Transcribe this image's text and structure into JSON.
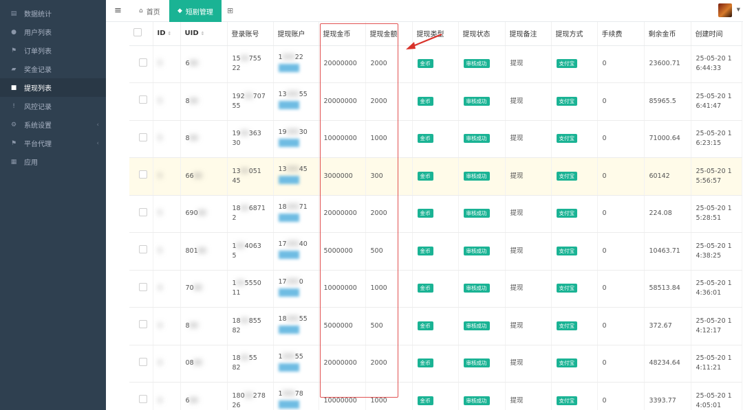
{
  "sidebar": {
    "items": [
      {
        "label": "数据统计",
        "icon": "chart-icon"
      },
      {
        "label": "用户列表",
        "icon": "user-icon"
      },
      {
        "label": "订单列表",
        "icon": "flag-icon"
      },
      {
        "label": "奖金记录",
        "icon": "book-icon"
      },
      {
        "label": "提现列表",
        "icon": "briefcase-icon",
        "active": true
      },
      {
        "label": "风控记录",
        "icon": "exclamation-icon"
      },
      {
        "label": "系统设置",
        "icon": "gear-icon",
        "has_children": true
      },
      {
        "label": "平台代理",
        "icon": "flag-icon",
        "has_children": true
      },
      {
        "label": "应用",
        "icon": "grid-icon"
      }
    ]
  },
  "topbar": {
    "home_label": "首页",
    "active_tab_label": "短剧管理"
  },
  "table": {
    "columns": [
      "ID",
      "UID",
      "登录账号",
      "提现账户",
      "提现金币",
      "提现金额",
      "提现类型",
      "提现状态",
      "提现备注",
      "提现方式",
      "手续费",
      "剩余金币",
      "创建时间"
    ],
    "rows": [
      {
        "id": "5",
        "uid": "6",
        "login": "15",
        "login2": "755",
        "login3": "22",
        "acct": "1",
        "acct2": "22",
        "coins": "20000000",
        "amount": "2000",
        "type": "金币",
        "status": "审核成功",
        "remark": "提现",
        "method": "支付宝",
        "fee": "0",
        "balance": "23600.71",
        "date": "25-05-20 1",
        "time": "6:44:33"
      },
      {
        "id": "5",
        "uid": "8",
        "login": "192",
        "login2": "707",
        "login3": "55",
        "acct": "13",
        "acct2": "55",
        "coins": "20000000",
        "amount": "2000",
        "type": "金币",
        "status": "审核成功",
        "remark": "提现",
        "method": "支付宝",
        "fee": "0",
        "balance": "85965.5",
        "date": "25-05-20 1",
        "time": "6:41:47"
      },
      {
        "id": "5",
        "uid": "8",
        "login": "19",
        "login2": "363",
        "login3": "30",
        "acct": "19",
        "acct2": "30",
        "coins": "10000000",
        "amount": "1000",
        "type": "金币",
        "status": "审核成功",
        "remark": "提现",
        "method": "支付宝",
        "fee": "0",
        "balance": "71000.64",
        "date": "25-05-20 1",
        "time": "6:23:15"
      },
      {
        "id": "5",
        "uid": "66",
        "login": "13",
        "login2": "051",
        "login3": "45",
        "acct": "13",
        "acct2": "45",
        "coins": "3000000",
        "amount": "300",
        "type": "金币",
        "status": "审核成功",
        "remark": "提现",
        "method": "支付宝",
        "fee": "0",
        "balance": "60142",
        "date": "25-05-20 1",
        "time": "5:56:57"
      },
      {
        "id": "5",
        "uid": "690",
        "login": "18",
        "login2": "6871",
        "login3": "2",
        "acct": "18",
        "acct2": "71",
        "coins": "20000000",
        "amount": "2000",
        "type": "金币",
        "status": "审核成功",
        "remark": "提现",
        "method": "支付宝",
        "fee": "0",
        "balance": "224.08",
        "date": "25-05-20 1",
        "time": "5:28:51"
      },
      {
        "id": "5",
        "uid": "801",
        "login": "1",
        "login2": "4063",
        "login3": "5",
        "acct": "17",
        "acct2": "40",
        "coins": "5000000",
        "amount": "500",
        "type": "金币",
        "status": "审核成功",
        "remark": "提现",
        "method": "支付宝",
        "fee": "0",
        "balance": "10463.71",
        "date": "25-05-20 1",
        "time": "4:38:25"
      },
      {
        "id": "4",
        "uid": "70",
        "login": "1",
        "login2": "5550",
        "login3": "11",
        "acct": "17",
        "acct2": "0",
        "coins": "10000000",
        "amount": "1000",
        "type": "金币",
        "status": "审核成功",
        "remark": "提现",
        "method": "支付宝",
        "fee": "0",
        "balance": "58513.84",
        "date": "25-05-20 1",
        "time": "4:36:01"
      },
      {
        "id": "4",
        "uid": "8",
        "login": "18",
        "login2": "855",
        "login3": "82",
        "acct": "18",
        "acct2": "55",
        "coins": "5000000",
        "amount": "500",
        "type": "金币",
        "status": "审核成功",
        "remark": "提现",
        "method": "支付宝",
        "fee": "0",
        "balance": "372.67",
        "date": "25-05-20 1",
        "time": "4:12:17"
      },
      {
        "id": "4",
        "uid": "08",
        "login": "18",
        "login2": "55",
        "login3": "82",
        "acct": "1",
        "acct2": "55",
        "coins": "20000000",
        "amount": "2000",
        "type": "金币",
        "status": "审核成功",
        "remark": "提现",
        "method": "支付宝",
        "fee": "0",
        "balance": "48234.64",
        "date": "25-05-20 1",
        "time": "4:11:21"
      },
      {
        "id": "4",
        "uid": "6",
        "login": "180",
        "login2": "278",
        "login3": "26",
        "acct": "1",
        "acct2": "78",
        "coins": "10000000",
        "amount": "1000",
        "type": "金币",
        "status": "审核成功",
        "remark": "提现",
        "method": "支付宝",
        "fee": "0",
        "balance": "3393.77",
        "date": "25-05-20 1",
        "time": "4:05:01"
      }
    ]
  },
  "colors": {
    "sidebar_bg": "#2f4050",
    "accent": "#1ab394",
    "annotation_red": "#e05050",
    "highlight_row": "#fffbe9"
  }
}
